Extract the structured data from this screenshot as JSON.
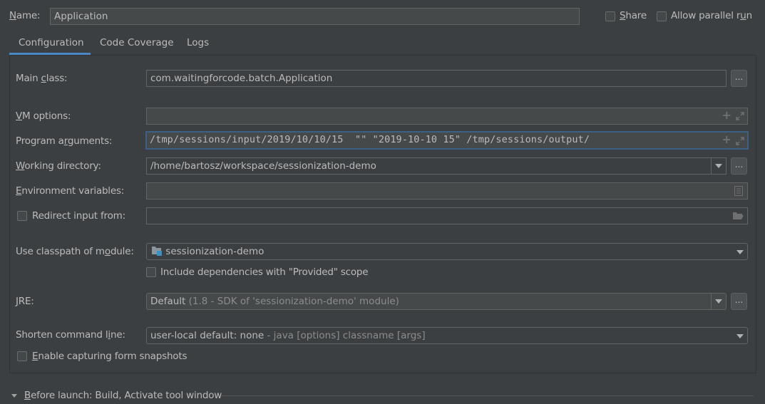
{
  "header": {
    "name_label_u": "N",
    "name_label_rest": "ame:",
    "name_value": "Application",
    "share": {
      "label_u": "S",
      "label_rest": "hare",
      "checked": false
    },
    "parallel": {
      "label_pre": "Allow parallel r",
      "label_u": "u",
      "label_post": "n",
      "checked": false
    }
  },
  "tabs": [
    {
      "label": "Configuration",
      "active": true
    },
    {
      "label": "Code Coverage",
      "active": false
    },
    {
      "label": "Logs",
      "active": false
    }
  ],
  "form": {
    "main_class": {
      "label_pre": "Main ",
      "label_u": "c",
      "label_post": "lass:",
      "value": "com.waitingforcode.batch.Application",
      "button": "..."
    },
    "vm_options": {
      "label_u": "V",
      "label_post": "M options:",
      "value": ""
    },
    "program_args": {
      "label_pre": "Program a",
      "label_u": "r",
      "label_post": "guments:",
      "value": "/tmp/sessions/input/2019/10/10/15  \"\" \"2019-10-10 15\" /tmp/sessions/output/"
    },
    "working_dir": {
      "label_u": "W",
      "label_post": "orking directory:",
      "value": "/home/bartosz/workspace/sessionization-demo",
      "button": "..."
    },
    "env_vars": {
      "label_u": "E",
      "label_post": "nvironment variables:",
      "value": ""
    },
    "redirect_input": {
      "label": "Redirect input from:",
      "checked": false,
      "value": ""
    },
    "classpath_module": {
      "label_pre": "Use classpath of m",
      "label_u": "o",
      "label_post": "dule:",
      "value": "sessionization-demo"
    },
    "include_provided": {
      "label": "Include dependencies with \"Provided\" scope",
      "checked": false
    },
    "jre": {
      "label_u": "J",
      "label_post": "RE:",
      "value_main": "Default",
      "value_detail": " (1.8 - SDK of 'sessionization-demo' module)",
      "button": "..."
    },
    "shorten_cmd": {
      "label_pre": "Shorten command l",
      "label_u": "i",
      "label_post": "ne:",
      "value_main": "user-local default: none",
      "value_detail": " - java [options] classname [args]"
    },
    "form_snapshots": {
      "label_u": "E",
      "label_post": "nable capturing form snapshots",
      "checked": false
    }
  },
  "before_launch": {
    "label_u": "B",
    "label_post": "efore launch: Build, Activate tool window"
  },
  "colors": {
    "accent": "#4a88c7",
    "focus_border": "#3d6185",
    "background": "#3c3f41",
    "field_bg": "#45494a"
  }
}
